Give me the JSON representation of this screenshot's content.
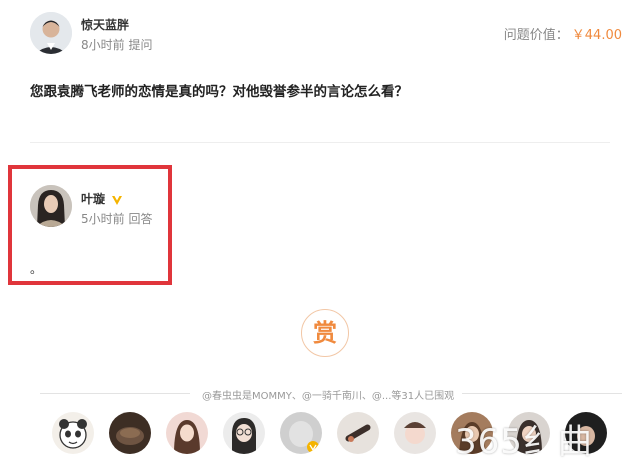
{
  "asker": {
    "name": "惊天蓝胖",
    "time": "8小时前",
    "action": "提问"
  },
  "question_value": {
    "label": "问题价值：",
    "amount": "￥44.00"
  },
  "question": {
    "text": "您跟袁腾飞老师的恋情是真的吗？对他毁誉参半的言论怎么看？"
  },
  "answer": {
    "name": "叶璇",
    "verified_icon": "verified-v-icon",
    "time": "5小时前",
    "action": "回答",
    "body": "。"
  },
  "reward": {
    "label": "赏"
  },
  "reward_summary": {
    "text": "@春虫虫是MOMMY、@一骑千南川、@...等31人已围观"
  },
  "supporters": {
    "avatars": [
      {
        "name": "supporter-avatar-1"
      },
      {
        "name": "supporter-avatar-2"
      },
      {
        "name": "supporter-avatar-3"
      },
      {
        "name": "supporter-avatar-4"
      },
      {
        "name": "supporter-avatar-5"
      },
      {
        "name": "supporter-avatar-6"
      },
      {
        "name": "supporter-avatar-7"
      },
      {
        "name": "supporter-avatar-8"
      },
      {
        "name": "supporter-avatar-9"
      },
      {
        "name": "supporter-avatar-10"
      },
      {
        "name": "supporter-avatar-11"
      }
    ]
  },
  "watermark": {
    "text": "365纟曲"
  },
  "colors": {
    "accent": "#f08a3e",
    "highlight": "#e0353b",
    "verified": "#f5b400"
  }
}
